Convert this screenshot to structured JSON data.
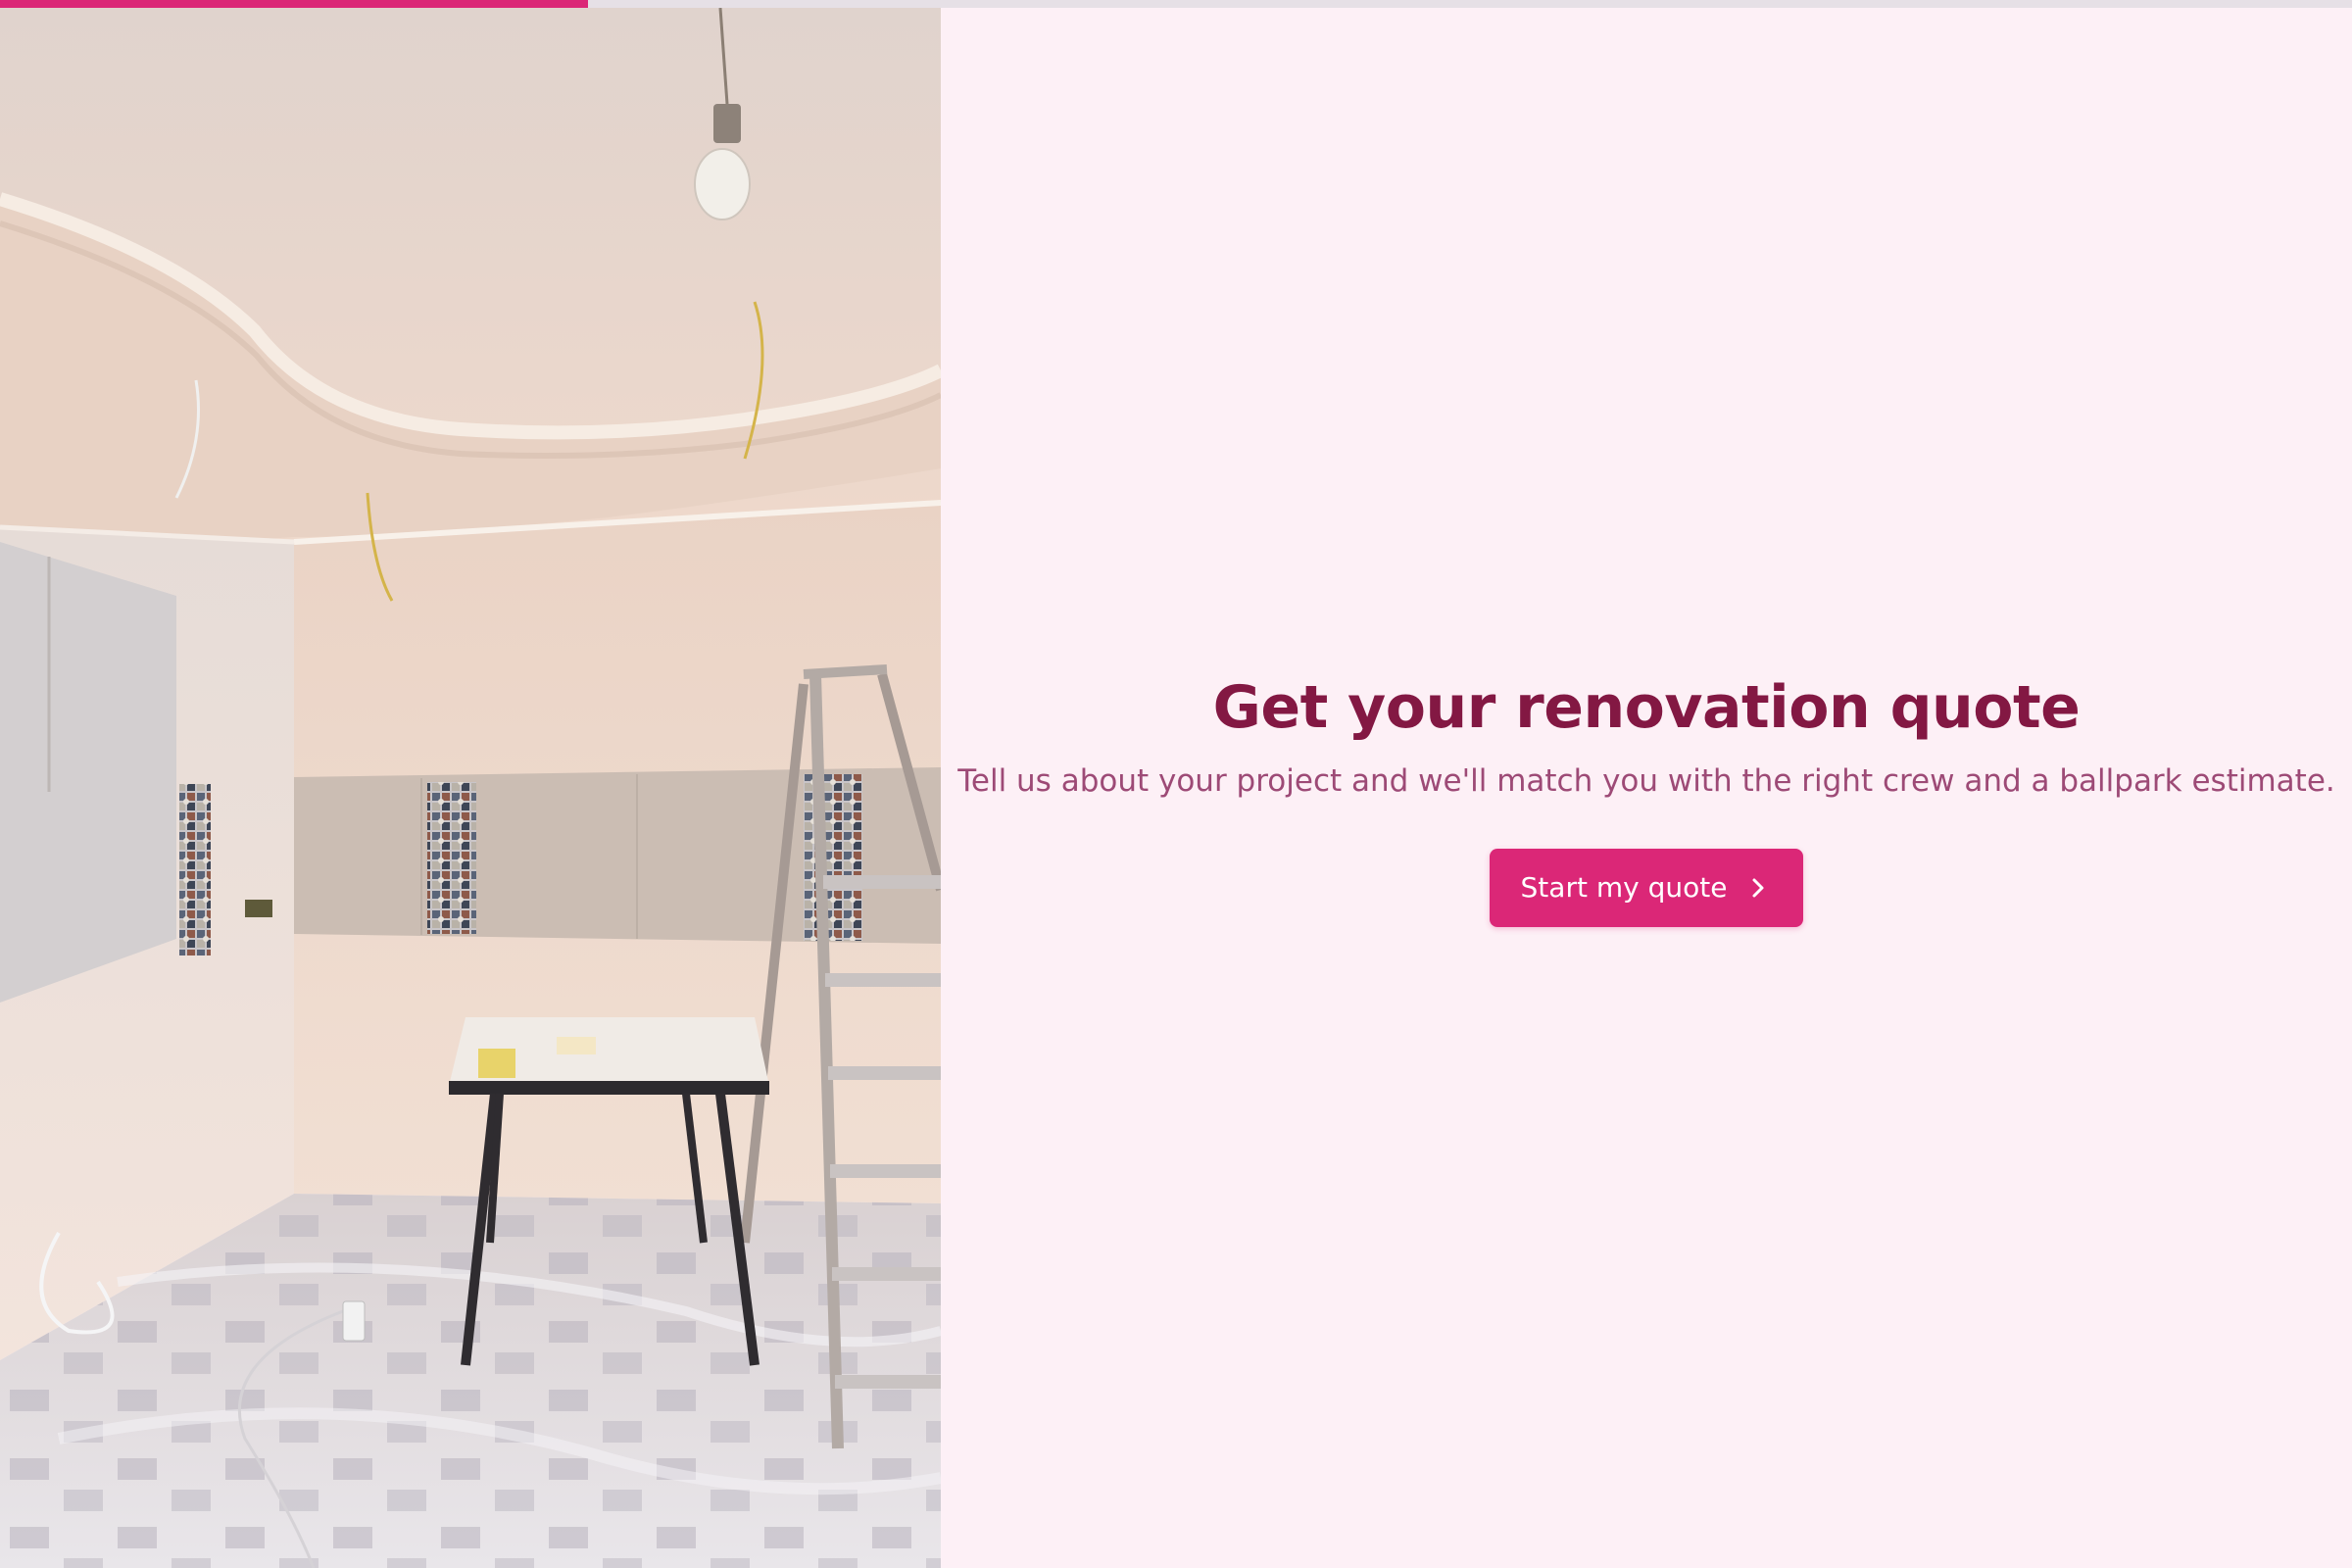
{
  "progress": {
    "value": 0.25,
    "color": "#db2777"
  },
  "hero_image": {
    "icon": "renovation-room-photo",
    "alt": "Room under renovation with ladder and table"
  },
  "main": {
    "headline": "Get your renovation quote",
    "subtext": "Tell us about your project and we'll match you with the right crew and a ballpark estimate.",
    "cta_label": "Start my quote",
    "cta_icon": "chevron-right-icon"
  },
  "colors": {
    "accent": "#db2777",
    "headline": "#831843",
    "subtext": "#9d4a76",
    "background": "#fdf0f6"
  }
}
